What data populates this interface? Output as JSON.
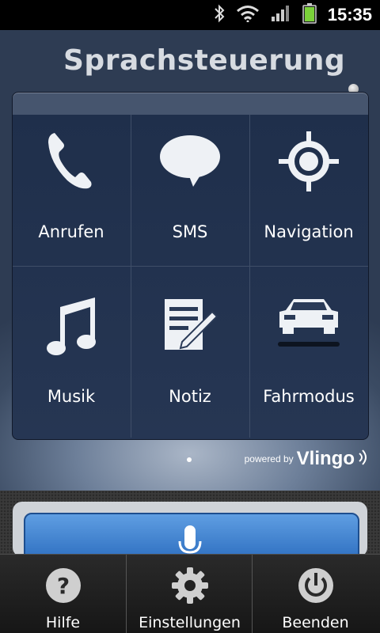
{
  "status_bar": {
    "time": "15:35",
    "icons": [
      "bluetooth-icon",
      "wifi-icon",
      "signal-icon",
      "battery-icon"
    ]
  },
  "header": {
    "title": "Sprachsteuerung"
  },
  "grid": {
    "items": [
      {
        "label": "Anrufen",
        "icon": "phone-icon"
      },
      {
        "label": "SMS",
        "icon": "speech-bubble-icon"
      },
      {
        "label": "Navigation",
        "icon": "crosshair-icon"
      },
      {
        "label": "Musik",
        "icon": "music-note-icon"
      },
      {
        "label": "Notiz",
        "icon": "note-pen-icon"
      },
      {
        "label": "Fahrmodus",
        "icon": "car-icon"
      }
    ]
  },
  "branding": {
    "powered_by": "powered by",
    "brand": "Vlingo"
  },
  "mic": {
    "icon": "microphone-icon",
    "color": "#3d7fd1"
  },
  "menu": {
    "items": [
      {
        "label": "Hilfe",
        "icon": "help-icon"
      },
      {
        "label": "Einstellungen",
        "icon": "gear-icon"
      },
      {
        "label": "Beenden",
        "icon": "power-icon"
      }
    ]
  },
  "colors": {
    "panel": "#1f2f4b",
    "title": "#d7dbe1",
    "accent_blue": "#3d7fd1",
    "battery": "#7bd13a"
  }
}
